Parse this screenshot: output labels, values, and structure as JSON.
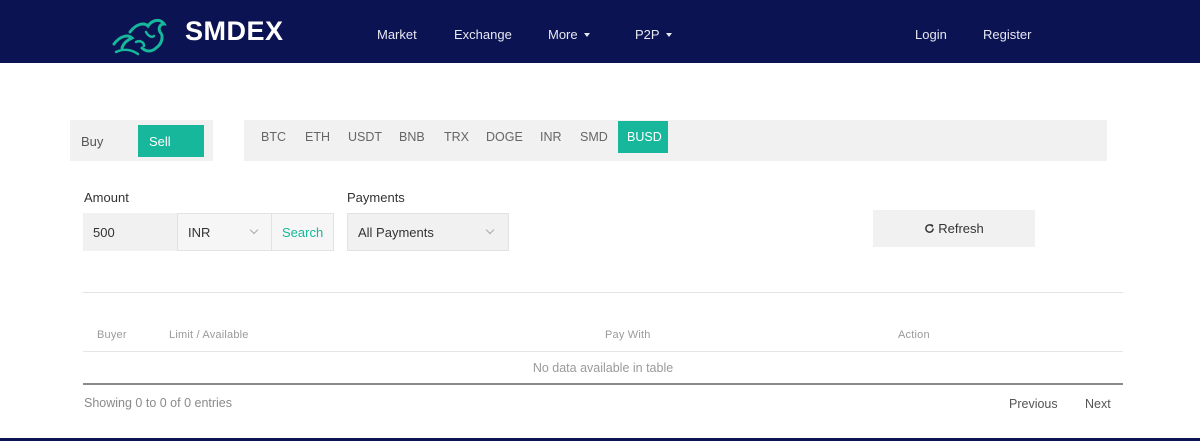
{
  "header": {
    "brand": "SMDEX",
    "nav": [
      {
        "label": "Market"
      },
      {
        "label": "Exchange"
      },
      {
        "label": "More"
      },
      {
        "label": "P2P"
      }
    ],
    "login_label": "Login",
    "register_label": "Register",
    "background_color": "#0c1353",
    "logo_color": "#16b79a"
  },
  "side_toggle": {
    "buy_label": "Buy",
    "sell_label": "Sell",
    "active": "Sell"
  },
  "coins": {
    "items": [
      "BTC",
      "ETH",
      "USDT",
      "BNB",
      "TRX",
      "DOGE",
      "INR",
      "SMD",
      "BUSD"
    ],
    "active": "BUSD"
  },
  "filters": {
    "amount_label": "Amount",
    "amount_value": "500",
    "currency_value": "INR",
    "search_label": "Search",
    "payments_label": "Payments",
    "payments_value": "All Payments",
    "refresh_label": "Refresh"
  },
  "table": {
    "columns": [
      "Buyer",
      "Limit / Available",
      "Pay With",
      "Action"
    ],
    "empty_message": "No data available in table",
    "info": "Showing 0 to 0 of 0 entries",
    "previous_label": "Previous",
    "next_label": "Next"
  },
  "accent_color": "#16b79a",
  "icons": {
    "logo": "lion-logo-icon",
    "nav_dropdown": "caret-down-icon",
    "select": "chevron-down-icon",
    "refresh": "refresh-icon"
  }
}
